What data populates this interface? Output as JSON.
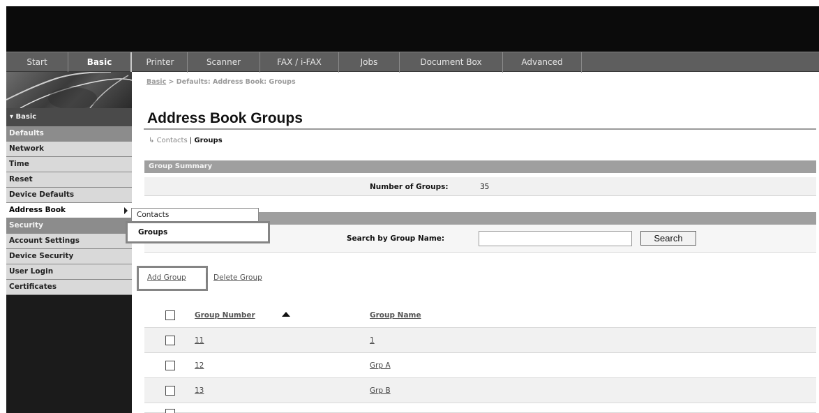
{
  "top_nav": {
    "tabs": [
      {
        "label": "Start"
      },
      {
        "label": "Basic",
        "active": true
      },
      {
        "label": "Printer"
      },
      {
        "label": "Scanner"
      },
      {
        "label": "FAX / i-FAX"
      },
      {
        "label": "Jobs"
      },
      {
        "label": "Document Box"
      },
      {
        "label": "Advanced"
      }
    ]
  },
  "sidebar": {
    "section_label": "▾ Basic",
    "items": [
      {
        "label": "Defaults",
        "type": "header"
      },
      {
        "label": "Network"
      },
      {
        "label": "Time"
      },
      {
        "label": "Reset"
      },
      {
        "label": "Device Defaults"
      },
      {
        "label": "Address Book",
        "current": true
      },
      {
        "label": "Security",
        "type": "header"
      },
      {
        "label": "Account Settings"
      },
      {
        "label": "Device Security"
      },
      {
        "label": "User Login"
      },
      {
        "label": "Certificates"
      }
    ]
  },
  "breadcrumb": {
    "root": "Basic",
    "separator": " > ",
    "path": "Defaults: Address Book: Groups"
  },
  "page": {
    "title": "Address Book Groups"
  },
  "subnav": {
    "contacts": "Contacts",
    "separator": " | ",
    "groups": "Groups"
  },
  "summary": {
    "section_title": "Group Summary",
    "label": "Number of Groups:",
    "value": "35"
  },
  "popup_menu": {
    "contacts": "Contacts",
    "groups": "Groups"
  },
  "search": {
    "label": "Search by Group Name:",
    "value": "",
    "button": "Search"
  },
  "actions": {
    "add": "Add Group",
    "delete": "Delete Group"
  },
  "table": {
    "headers": {
      "number": "Group Number",
      "name": "Group Name"
    },
    "sort_icon": "sort-ascending-icon",
    "rows": [
      {
        "number": "11",
        "name": "1"
      },
      {
        "number": "12",
        "name": "Grp A"
      },
      {
        "number": "13",
        "name": "Grp B"
      }
    ]
  },
  "colors": {
    "header_bar": "#0b0b0b",
    "nav_bar": "#5e5e5e",
    "section_bar": "#9f9f9f",
    "sidebar_header": "#8c8c8c"
  }
}
